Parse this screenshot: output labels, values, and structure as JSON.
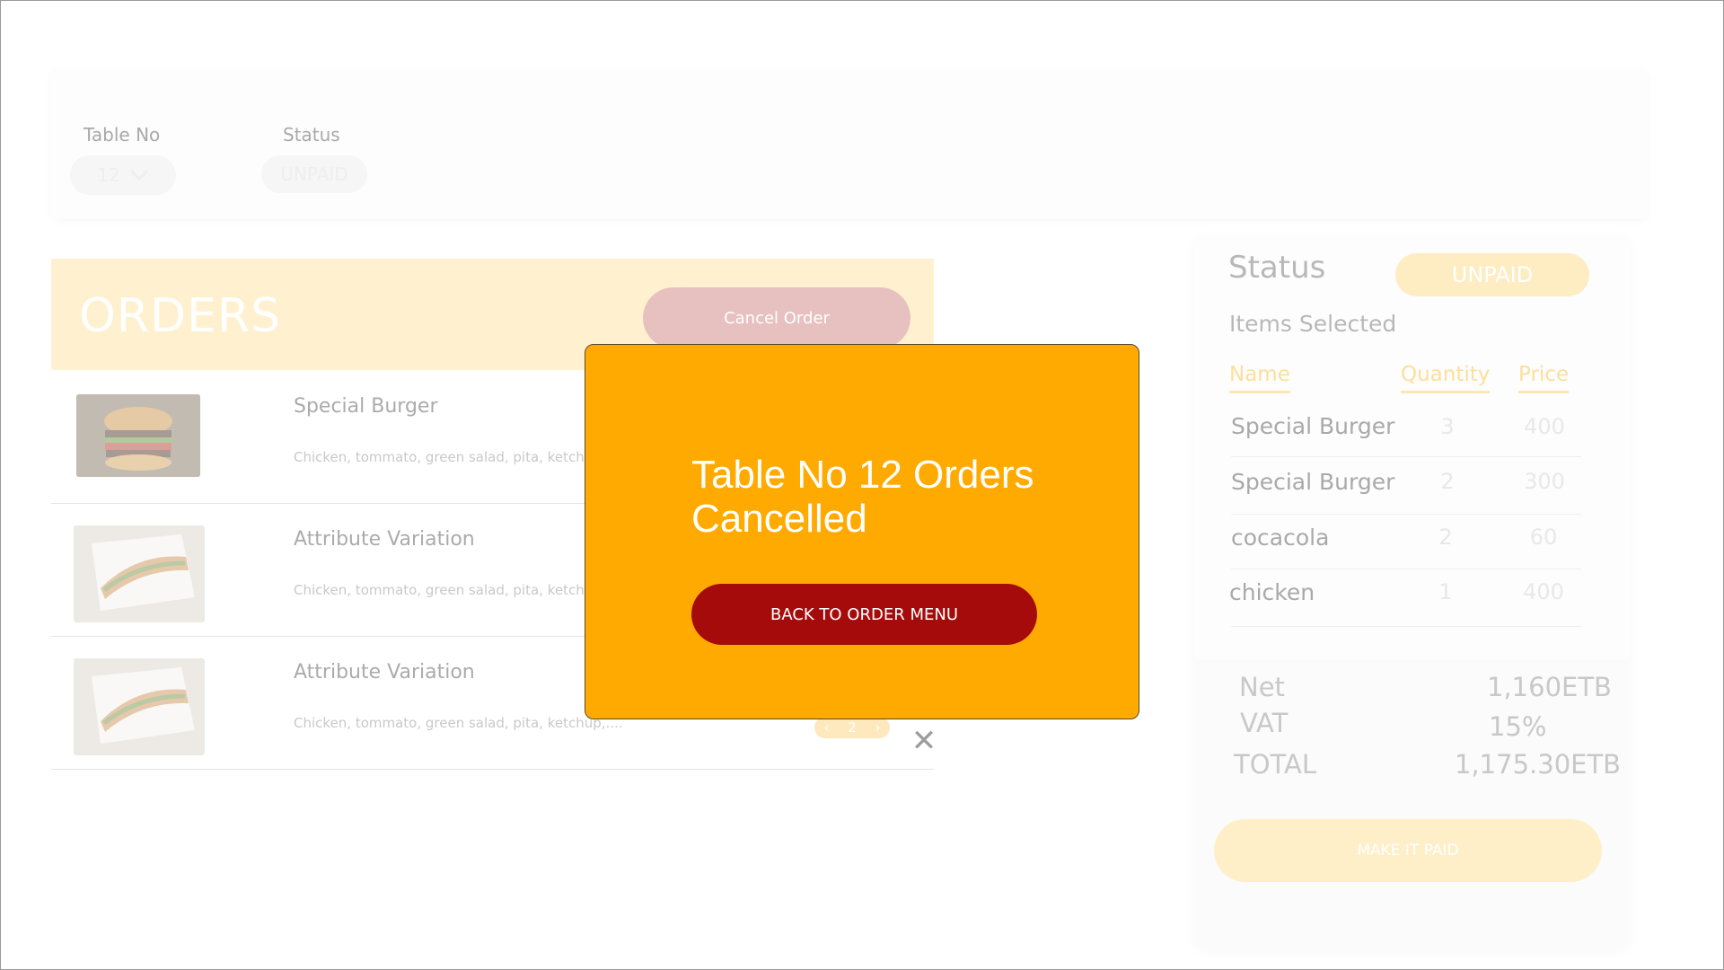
{
  "filters": {
    "table_label": "Table No",
    "table_value": "12",
    "status_label": "Status",
    "status_value": "UNPAID"
  },
  "orders": {
    "title": "ORDERS",
    "cancel_label": "Cancel Order",
    "items": [
      {
        "name": "Special Burger",
        "desc": "Chicken, tommato, green salad, pita, ketchup,....",
        "image": "burger"
      },
      {
        "name": "Attribute Variation",
        "desc": "Chicken, tommato, green salad, pita, ketchup,....",
        "image": "sandwich"
      },
      {
        "name": "Attribute Variation",
        "desc": "Chicken, tommato, green salad, pita, ketchup,....",
        "image": "sandwich"
      }
    ],
    "page": "2"
  },
  "summary": {
    "status_label": "Status",
    "status_value": "UNPAID",
    "items_label": "Items Selected",
    "headers": {
      "name": "Name",
      "quantity": "Quantity",
      "price": "Price"
    },
    "rows": [
      {
        "name": "Special Burger",
        "qty": "3",
        "price": "400"
      },
      {
        "name": "Special Burger",
        "qty": "2",
        "price": "300"
      },
      {
        "name": "cocacola",
        "qty": "2",
        "price": "60"
      },
      {
        "name": "chicken",
        "qty": "1",
        "price": "400"
      }
    ],
    "net_label": "Net",
    "net_value": "1,160ETB",
    "vat_label": "VAT",
    "vat_value": "15%",
    "total_label": "TOTAL",
    "total_value": "1,175.30ETB",
    "pay_label": "MAKE IT PAID"
  },
  "modal": {
    "title": "Table No 12 Orders Cancelled",
    "button_label": "BACK TO ORDER MENU"
  },
  "colors": {
    "modal_bg": "#ffaa00",
    "modal_button": "#a60b0b",
    "accent_light": "#fff1cf"
  }
}
